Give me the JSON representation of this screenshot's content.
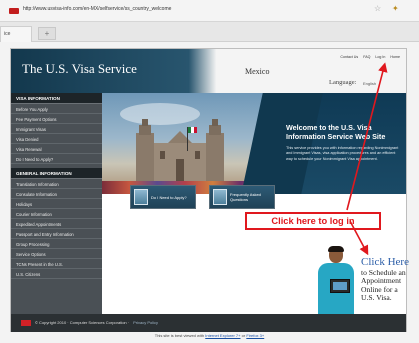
{
  "browser": {
    "url": "http://www.usvisa-info.com/en-MX/selfservice/ss_country_welcome",
    "tab_label": "ice",
    "new_tab_label": "+",
    "star_icon": "star-icon",
    "extension_icon": "puzzle-icon"
  },
  "header": {
    "site_title": "The U.S. Visa Service",
    "country": "Mexico",
    "links": [
      "Contact Us",
      "FAQ",
      "Log In",
      "Home"
    ],
    "language_label": "Language:",
    "language_value": "English"
  },
  "sidebar": {
    "visa_heading": "VISA INFORMATION",
    "visa_items": [
      "Before You Apply",
      "Fee Payment Options",
      "Immigrant Visas",
      "Visa Denied",
      "Visa Renewal",
      "Do I Need to Apply?"
    ],
    "general_heading": "GENERAL INFORMATION",
    "general_items": [
      "Translation Information",
      "Consulate Information",
      "Holidays",
      "Courier Information",
      "Expedited Appointments",
      "Passport and Entry Information",
      "Group Processing",
      "Service Options",
      "TCNs Present in the U.S.",
      "U.S. Citizens"
    ]
  },
  "hero": {
    "title": "Welcome to the U.S. Visa Information Service Web Site",
    "body": "This service provides you with information regarding Nonimmigrant and Immigrant Visas, visa application procedures and an efficient way to schedule your Nonimmigrant Visa appointment."
  },
  "callout": {
    "login_text": "Click here to log in",
    "click_here": "Click Here",
    "click_desc": "to Schedule an Appointment Online for a U.S. Visa."
  },
  "buttons": {
    "apply": "Do I Need to Apply?",
    "faq": "Frequently Asked Questions"
  },
  "footer": {
    "copyright": "© Copyright 2010 · Computer Sciences Corporation ·",
    "privacy": "Privacy Policy"
  },
  "best_viewed": {
    "prefix": "This site is best viewed with",
    "ie": "Internet Explorer 7+",
    "or": "or",
    "firefox": "Firefox 3+"
  },
  "colors": {
    "callout_red": "#e0181e",
    "brand_dark": "#13384d",
    "click_here_blue": "#2c5ea8"
  }
}
